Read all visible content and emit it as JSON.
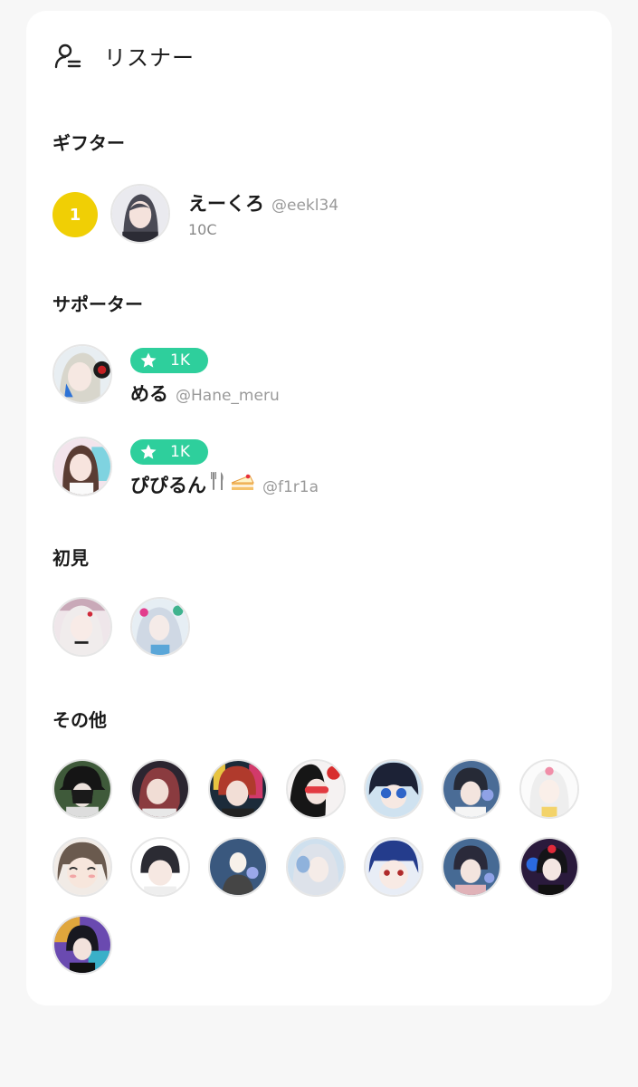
{
  "header": {
    "title": "リスナー",
    "icon": "user-list-icon"
  },
  "sections": {
    "gifter": "ギフター",
    "supporter": "サポーター",
    "first_time": "初見",
    "others": "その他"
  },
  "gifters": [
    {
      "rank": "1",
      "name": "えーくろ",
      "handle": "@eekl34",
      "coins": "10C"
    }
  ],
  "supporters": [
    {
      "level": "1K",
      "name": "める",
      "handle": "@Hane_meru"
    },
    {
      "level": "1K",
      "name": "ぴぴるん",
      "handle": "@f1r1a",
      "name_emoji": [
        "fork-knife-icon",
        "cake-icon"
      ]
    }
  ],
  "colors": {
    "background": "#f7f7f7",
    "card": "#ffffff",
    "rank_badge": "#f0cf05",
    "level_badge": "#2ecf9c",
    "handle_text": "#9a9a9a"
  }
}
